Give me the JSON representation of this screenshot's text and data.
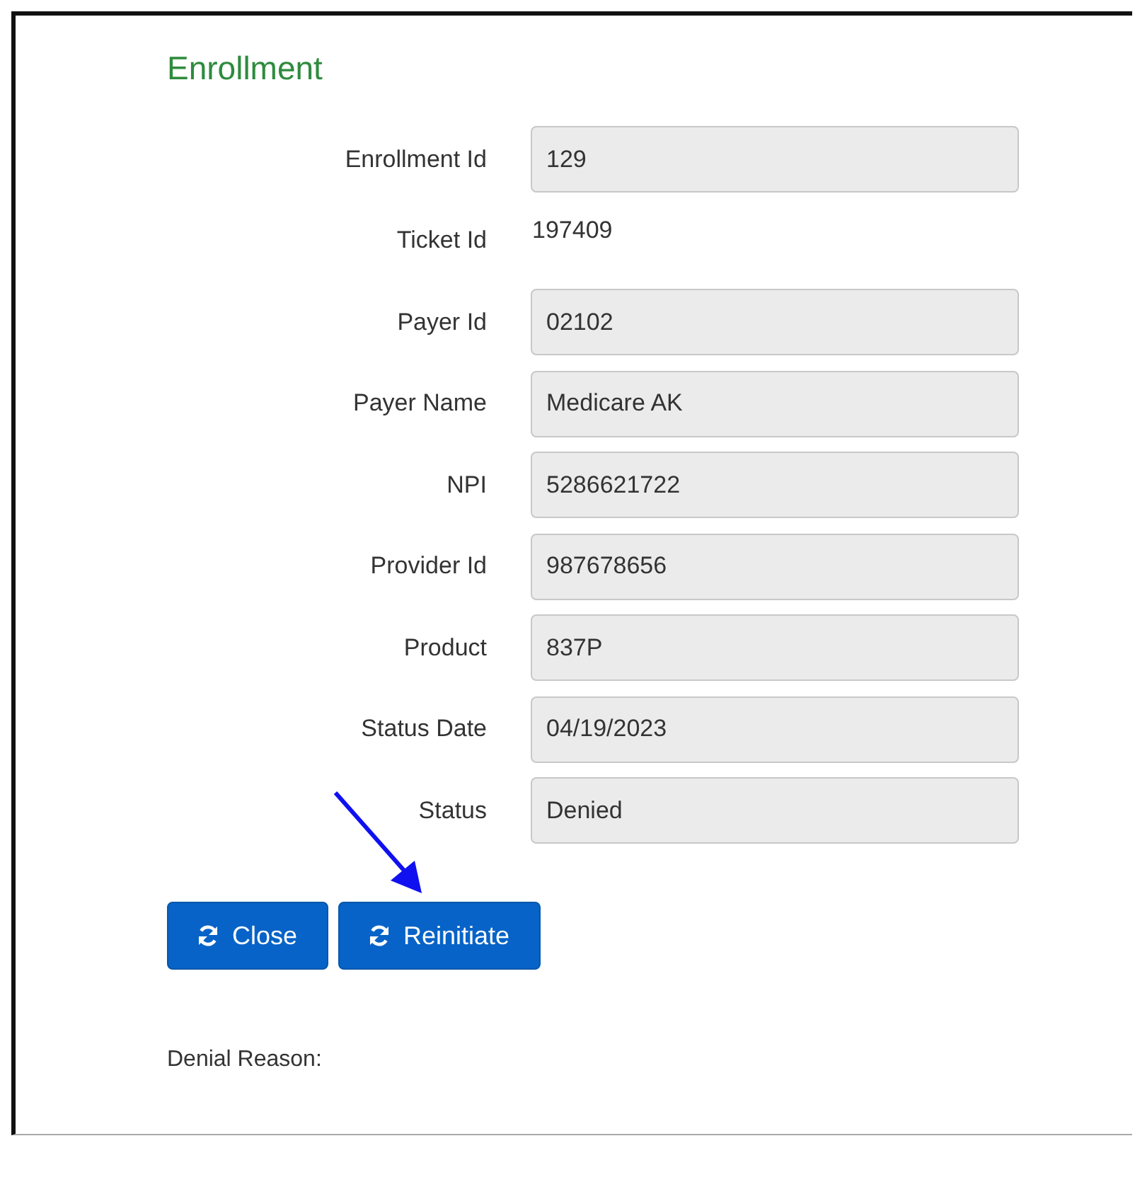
{
  "title": "Enrollment",
  "fields": [
    {
      "label": "Enrollment Id",
      "value": "129",
      "kind": "input"
    },
    {
      "label": "Ticket Id",
      "value": "197409",
      "kind": "text"
    },
    {
      "label": "Payer Id",
      "value": "02102",
      "kind": "input"
    },
    {
      "label": "Payer Name",
      "value": "Medicare AK",
      "kind": "input"
    },
    {
      "label": "NPI",
      "value": "5286621722",
      "kind": "input"
    },
    {
      "label": "Provider Id",
      "value": "987678656",
      "kind": "input"
    },
    {
      "label": "Product",
      "value": "837P",
      "kind": "input"
    },
    {
      "label": "Status Date",
      "value": "04/19/2023",
      "kind": "input"
    },
    {
      "label": "Status",
      "value": "Denied",
      "kind": "input"
    }
  ],
  "buttons": [
    {
      "label": "Close"
    },
    {
      "label": "Reinitiate"
    }
  ],
  "denial_reason": {
    "label": "Denial Reason:"
  }
}
